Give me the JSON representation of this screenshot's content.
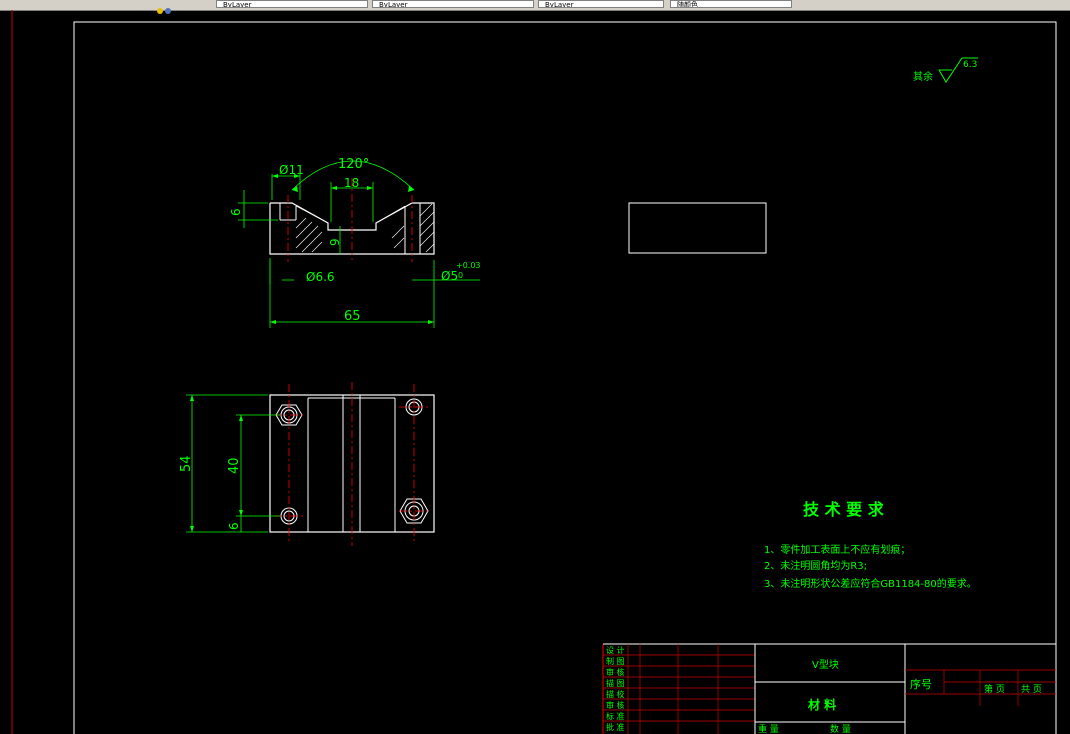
{
  "toolbar": {
    "fields": [
      "ByLayer",
      "ByLayer",
      "ByLayer",
      "随颜色"
    ]
  },
  "drawing": {
    "roughness": {
      "prefix": "其余",
      "value": "6.3"
    },
    "front_view": {
      "angle": "120°",
      "dims": {
        "hole_top": "Ø11",
        "slot_width": "18",
        "depth_left": "6",
        "depth_mid": "9",
        "hole_bottom": "Ø6.6",
        "pin_hole": "Ø5",
        "tol_upper": "+0.03",
        "tol_lower": "0",
        "length": "65"
      }
    },
    "top_view": {
      "dims": {
        "width": "54",
        "pitch": "40",
        "edge": "6"
      }
    },
    "tech_req": {
      "title": "技 术 要 求",
      "items": [
        "1、零件加工表面上不应有划痕；",
        "2、未注明圆角均为R3;",
        "3、未注明形状公差应符合GB1184-80的要求。"
      ]
    },
    "title_block": {
      "part_name": "V型块",
      "material": "材 料",
      "seq": "序号",
      "sheet": "第 页",
      "total": "共 页",
      "weight": "重 量",
      "scale": "数 量",
      "rows": [
        "设 计",
        "制 图",
        "审 核",
        "描 图",
        "描 校",
        "审 核",
        "标 准",
        "批 准"
      ]
    }
  },
  "colors": {
    "background": "#000000",
    "frame": "#ffffff",
    "geometry": "#ffffff",
    "dimension": "#00ff00",
    "centerline": "#ff0000",
    "hatch": "#ffffff",
    "border_red": "#cc0000"
  }
}
